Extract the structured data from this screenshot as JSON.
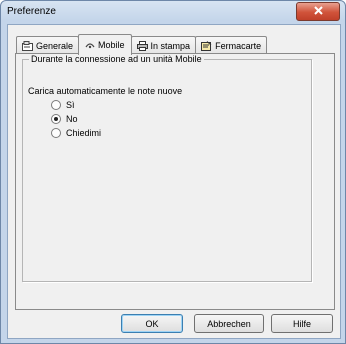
{
  "window": {
    "title": "Preferenze"
  },
  "tabs": [
    {
      "label": "Generale",
      "icon": "settings-icon"
    },
    {
      "label": "Mobile",
      "icon": "mobile-icon",
      "active": true
    },
    {
      "label": "In stampa",
      "icon": "printer-icon"
    },
    {
      "label": "Fermacarte",
      "icon": "clipboard-icon"
    }
  ],
  "group": {
    "legend": "Durante la connessione ad un unità Mobile",
    "prompt": "Carica automaticamente le note nuove",
    "options": [
      {
        "label": "Sì",
        "selected": false
      },
      {
        "label": "No",
        "selected": true
      },
      {
        "label": "Chiedimi",
        "selected": false
      }
    ]
  },
  "buttons": {
    "ok": "OK",
    "cancel": "Abbrechen",
    "help": "Hilfe"
  }
}
